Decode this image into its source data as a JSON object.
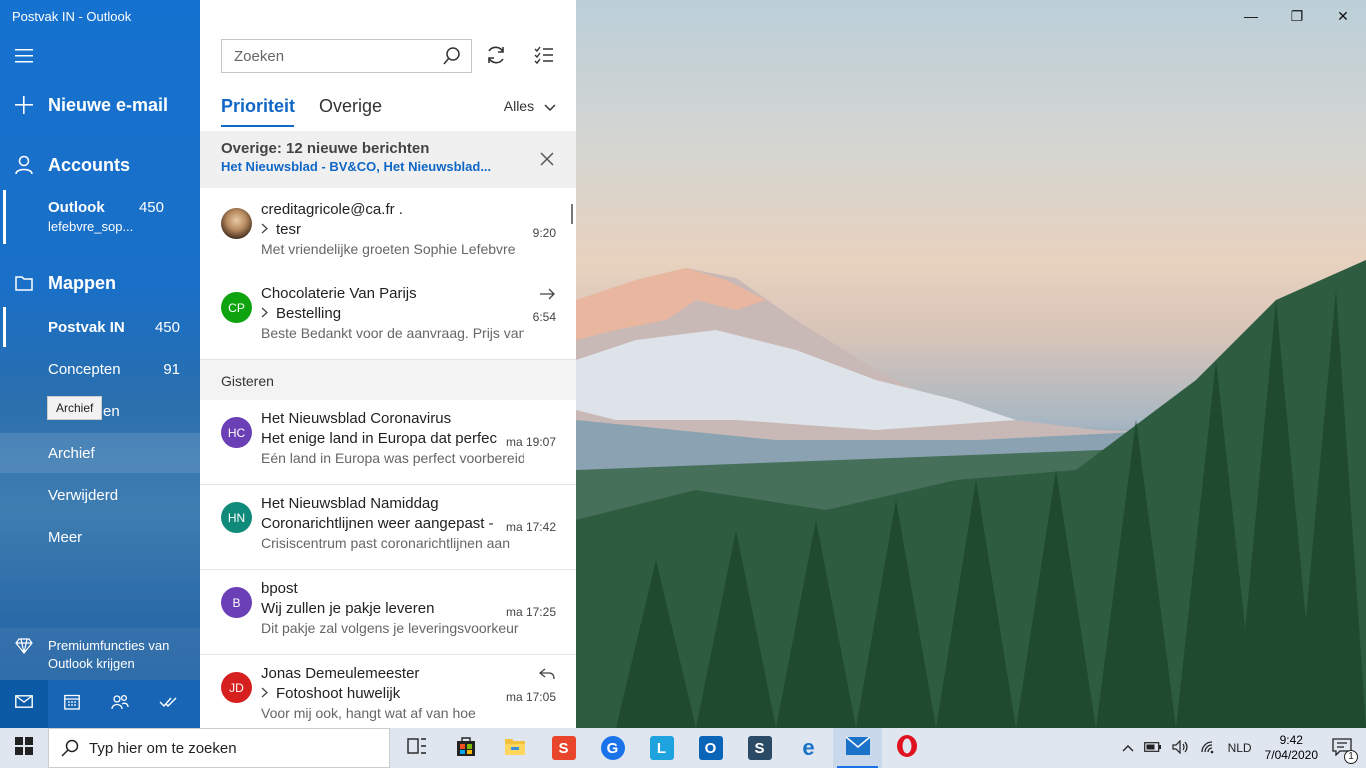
{
  "window": {
    "title": "Postvak IN - Outlook",
    "controls": [
      "minimize-icon",
      "restore-icon",
      "close-icon"
    ]
  },
  "nav": {
    "new_mail": "Nieuwe e-mail",
    "accounts_label": "Accounts",
    "account": {
      "name": "Outlook",
      "email": "lefebvre_sop...",
      "count": "450"
    },
    "folders_label": "Mappen",
    "folders": [
      {
        "label": "Postvak IN",
        "count": "450"
      },
      {
        "label": "Concepten",
        "count": "91"
      },
      {
        "label": "Verzonden",
        "count": ""
      },
      {
        "label": "Archief",
        "count": ""
      },
      {
        "label": "Verwijderd",
        "count": ""
      },
      {
        "label": "Meer",
        "count": ""
      }
    ],
    "folder_partial_visible": "en",
    "tooltip": "Archief",
    "premium": "Premiumfuncties van Outlook krijgen"
  },
  "list": {
    "search_placeholder": "Zoeken",
    "tabs": [
      {
        "label": "Prioriteit",
        "active": true
      },
      {
        "label": "Overige",
        "active": false
      }
    ],
    "filter": "Alles",
    "banner": {
      "title": "Overige: 12 nieuwe berichten",
      "subtitle": "Het Nieuwsblad - BV&CO, Het Nieuwsblad..."
    },
    "section": "Gisteren",
    "messages": [
      {
        "sender": "creditagricole@ca.fr .",
        "subject": "tesr",
        "preview": "Met vriendelijke groeten Sophie Lefebvre",
        "time": "9:20",
        "avatar": "",
        "color": "#8a6a4a",
        "thread": true,
        "status": ""
      },
      {
        "sender": "Chocolaterie Van Parijs",
        "subject": "Bestelling",
        "preview": "Beste Bedankt voor de aanvraag. Prijs van",
        "time": "6:54",
        "avatar": "CP",
        "color": "#10a310",
        "thread": true,
        "status": "forward-icon"
      },
      {
        "sender": "Het Nieuwsblad Coronavirus",
        "subject": "Het enige land in Europa dat perfect",
        "preview": "Eén land in Europa was perfect voorbereid",
        "time": "ma 19:07",
        "avatar": "HC",
        "color": "#6b3fb5",
        "thread": false,
        "status": ""
      },
      {
        "sender": "Het Nieuwsblad Namiddag",
        "subject": "Coronarichtlijnen weer aangepast -",
        "preview": "Crisiscentrum past coronarichtlijnen aan",
        "time": "ma 17:42",
        "avatar": "HN",
        "color": "#108a7a",
        "thread": false,
        "status": ""
      },
      {
        "sender": "bpost",
        "subject": "Wij zullen je pakje leveren",
        "preview": "Dit pakje zal volgens je leveringsvoorkeur",
        "time": "ma 17:25",
        "avatar": "B",
        "color": "#6b3fb5",
        "thread": false,
        "status": ""
      },
      {
        "sender": "Jonas Demeulemeester",
        "subject": "Fotoshoot huwelijk",
        "preview": "Voor mij ook, hangt wat af van hoe",
        "time": "ma 17:05",
        "avatar": "JD",
        "color": "#d62020",
        "thread": true,
        "status": "reply-icon"
      }
    ]
  },
  "taskbar": {
    "search_text": "Typ hier om te zoeken",
    "apps": [
      "task-view-icon",
      "store-icon",
      "file-explorer-icon",
      "app-s-icon",
      "google-icon",
      "app-l-icon",
      "outlook-desktop-icon",
      "app-s2-icon",
      "edge-icon",
      "mail-icon",
      "opera-icon"
    ],
    "language": "NLD",
    "time": "9:42",
    "date": "7/04/2020",
    "notifications": "1"
  },
  "colors": {
    "accent": "#1167c6",
    "nav_blue": "#1572d0",
    "taskbar": "#dfe6ef"
  }
}
